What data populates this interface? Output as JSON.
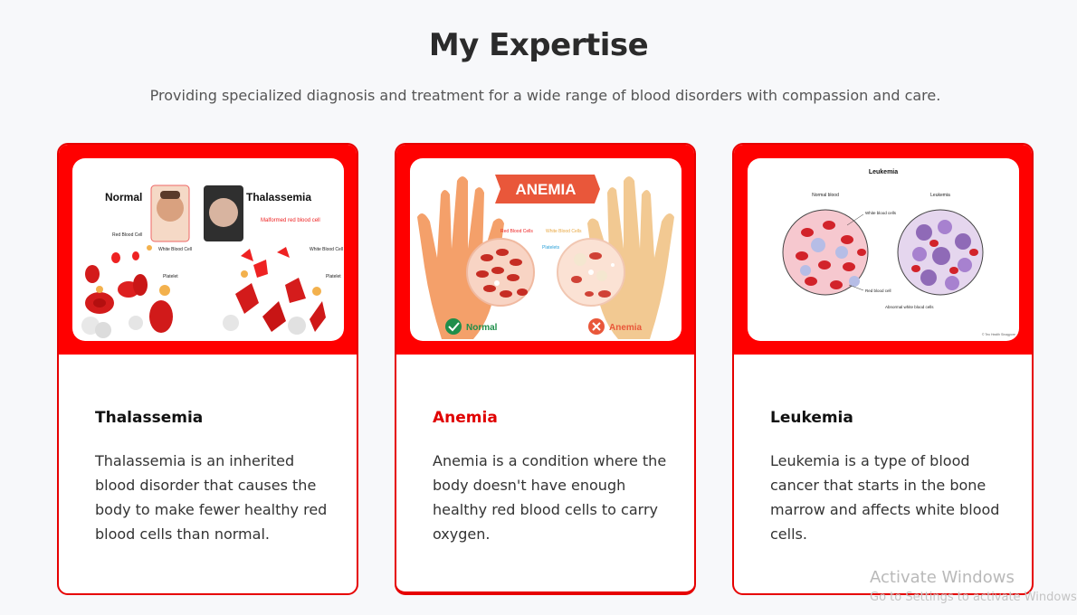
{
  "section": {
    "title": "My Expertise",
    "subtitle": "Providing specialized diagnosis and treatment for a wide range of blood disorders with compassion and care."
  },
  "cards": [
    {
      "title": "Thalassemia",
      "description": "Thalassemia is an inherited blood disorder that causes the body to make fewer healthy red blood cells than normal.",
      "image": {
        "label_left": "Normal",
        "label_right": "Thalassemia",
        "callouts": [
          "Red Blood Cell",
          "White Blood Cell",
          "Platelet",
          "Malformed red blood cell",
          "White Blood Cell",
          "Platelet"
        ]
      }
    },
    {
      "title": "Anemia",
      "description": "Anemia is a condition where the body doesn't have enough healthy red blood cells to carry oxygen.",
      "image": {
        "banner": "ANEMIA",
        "callouts": [
          "Red Blood Cells",
          "White Blood Cells",
          "Platelets"
        ],
        "normal_label": "Normal",
        "anemia_label": "Anemia"
      }
    },
    {
      "title": "Leukemia",
      "description": "Leukemia is a type of blood cancer that starts in the bone marrow and affects white blood cells.",
      "image": {
        "heading": "Leukemia",
        "left_label": "Normal blood",
        "right_label": "Leukemia",
        "callouts": [
          "White blood cells",
          "Red blood cell",
          "Abnormal white blood cells"
        ],
        "credit": "© Teo Health Sinagpore"
      }
    }
  ],
  "watermark": {
    "line1": "Activate Windows",
    "line2": "Go to Settings to activate Windows."
  },
  "colors": {
    "accent": "#ff0000",
    "card_border": "#e60000",
    "active_title": "#e00000"
  }
}
